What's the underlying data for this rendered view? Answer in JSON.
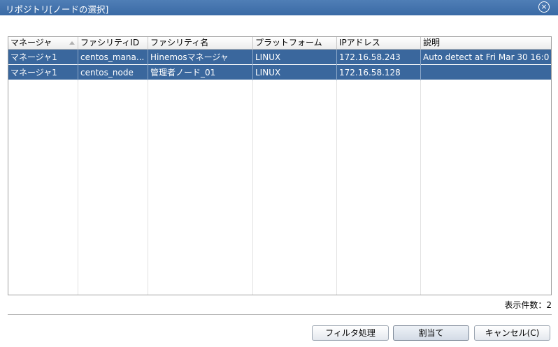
{
  "dialog": {
    "title": "リポジトリ[ノードの選択]",
    "close_glyph": "×"
  },
  "table": {
    "columns": [
      "マネージャ",
      "ファシリティID",
      "ファシリティ名",
      "プラットフォーム",
      "IPアドレス",
      "説明"
    ],
    "rows": [
      [
        "マネージャ1",
        "centos_mana...",
        "Hinemosマネージャ",
        "LINUX",
        "172.16.58.243",
        "Auto detect at Fri Mar 30 16:0"
      ],
      [
        "マネージャ1",
        "centos_node",
        "管理者ノード_01",
        "LINUX",
        "172.16.58.128",
        ""
      ]
    ],
    "sort_column": "マネージャ"
  },
  "footer": {
    "count_label": "表示件数：2",
    "buttons": {
      "filter": "フィルタ処理",
      "assign": "割当て",
      "cancel": "キャンセル(C)"
    }
  }
}
